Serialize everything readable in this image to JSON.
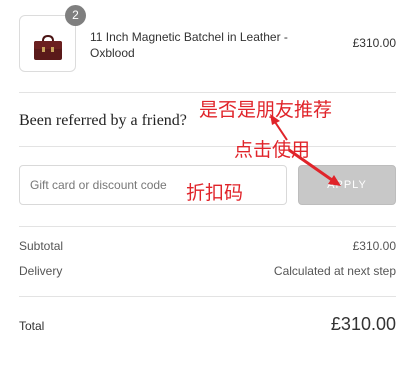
{
  "cart": {
    "quantity": "2",
    "product_name": "11 Inch Magnetic Batchel in Leather - Oxblood",
    "product_price": "£310.00"
  },
  "referral": {
    "text": "Been referred by a friend?"
  },
  "discount": {
    "placeholder": "Gift card or discount code",
    "apply_label": "APPLY"
  },
  "summary": {
    "subtotal_label": "Subtotal",
    "subtotal_value": "£310.00",
    "delivery_label": "Delivery",
    "delivery_value": "Calculated at next step",
    "total_label": "Total",
    "total_value": "£310.00"
  },
  "annotations": {
    "referral_note": "是否是朋友推荐",
    "click_note": "点击使用",
    "discount_note": "折扣码",
    "color": "#e0242a"
  },
  "colors": {
    "badge": "#7f7f7f",
    "apply_button": "#c8c8c8",
    "product": "#5a1a1a"
  }
}
